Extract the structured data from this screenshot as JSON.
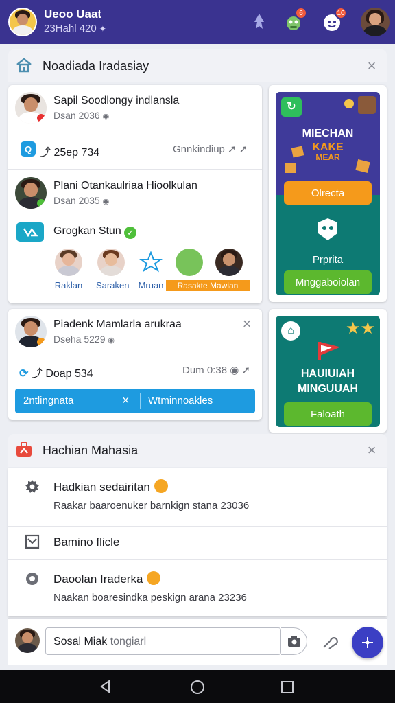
{
  "header": {
    "user_name": "Ueoo Uaat",
    "user_sub": "23Hahl 420",
    "badges": [
      "6",
      "10"
    ]
  },
  "section1": {
    "title": "Noadiada Iradasiay",
    "post1": {
      "title": "Sapil Soodlongy indlansla",
      "meta": "Dsan 2036",
      "stat_left": "25ep 734",
      "stat_right": "Gnnkindiup"
    },
    "post2": {
      "title": "Plani Otankaulriaa Hioolkulan",
      "meta": "Dsan 2035",
      "group": "Grogkan Stun",
      "people": [
        "Raklan",
        "Saraken",
        "Mruan",
        "Rasakte Mawian"
      ]
    },
    "post3": {
      "title": "Piadenk Mamlarla arukraa",
      "meta": "Dseha 5229",
      "stat_left": "Doap 534",
      "stat_right": "Dum 0:38",
      "btn_left": "2ntlingnata",
      "btn_right": "Wtminnoakles"
    },
    "promo1": {
      "headline1": "MIECHAN",
      "headline2": "KAKE",
      "headline3": "MEAR",
      "btn1": "Olrecta",
      "label": "Prprita",
      "btn2": "Mnggaboiolan"
    },
    "promo2": {
      "headline1": "HAUIUIAH",
      "headline2": "MINGUUAH",
      "btn": "Faloath"
    }
  },
  "section2": {
    "title": "Hachian Mahasia",
    "items": [
      {
        "title": "Hadkian sedairitan",
        "sub": "Raakar baaroenuker barnkign stana 23036"
      },
      {
        "title": "Bamino flicle",
        "sub": ""
      },
      {
        "title": "Daoolan Iraderka",
        "sub": "Naakan boaresindka peskign arana 23236"
      }
    ]
  },
  "composer": {
    "text": "Sosal Miak",
    "placeholder": "tongiarl"
  },
  "colors": {
    "appbar": "#3a3390",
    "accent_blue": "#1e9be0",
    "promo_purple": "#3f3a9a",
    "promo_orange": "#f59a1b",
    "promo_teal": "#0d7a73",
    "promo_green": "#5cb82e",
    "fab": "#3b3fc4"
  }
}
